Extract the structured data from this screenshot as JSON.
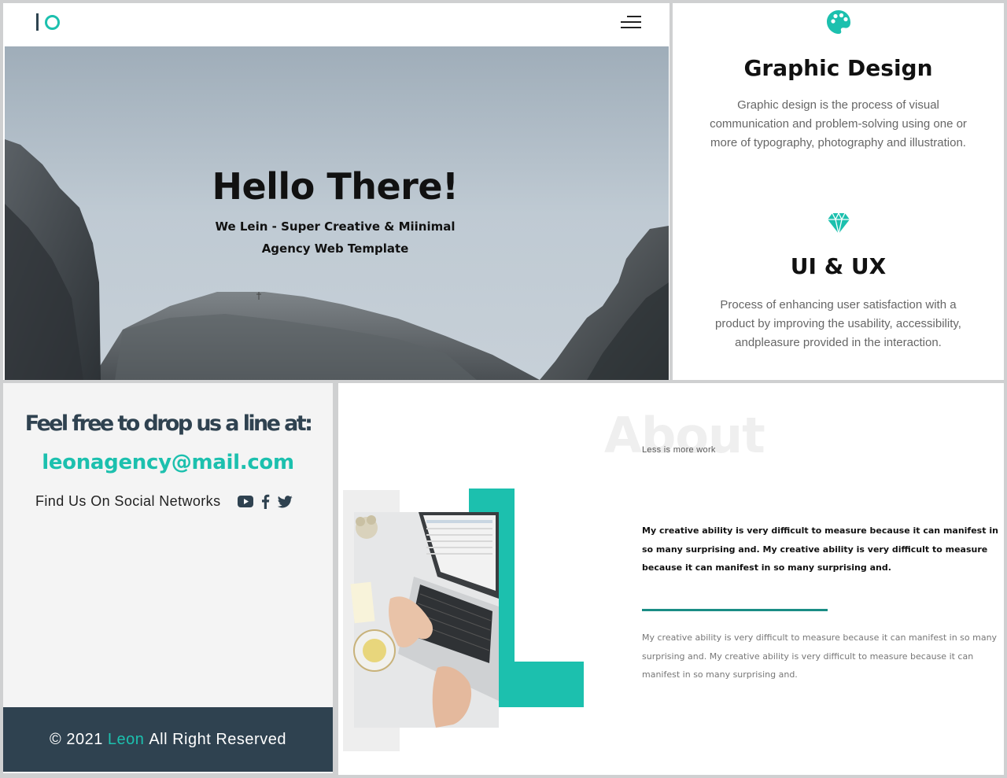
{
  "hero": {
    "title": "Hello There!",
    "subtitle_line1": "We Lein - Super Creative & Miinimal",
    "subtitle_line2": "Agency Web Template",
    "colors": {
      "accent": "#1cc0ae",
      "logo_dark": "#2e4450"
    },
    "icons": {
      "logo": "logo-io-mark",
      "menu": "hamburger-menu-icon"
    }
  },
  "services": [
    {
      "icon": "palette-icon",
      "title": "Graphic Design",
      "description": "Graphic design is the process of visual communication and problem-solving using one or more of typography, photography and illustration."
    },
    {
      "icon": "diamond-icon",
      "title": "UI & UX",
      "description": "Process of enhancing user satisfaction with a product by improving the usability, accessibility, andpleasure provided in the interaction."
    }
  ],
  "contact": {
    "heading": "Feel free to drop us a line at:",
    "email": "leonagency@mail.com",
    "social_label": "Find Us On Social Networks",
    "social_icons": [
      "youtube-icon",
      "facebook-icon",
      "twitter-icon"
    ]
  },
  "footer": {
    "copyright_prefix": "© 2021",
    "brand": "Leon",
    "suffix": "All Right Reserved",
    "colors": {
      "background": "#2f4250",
      "brand": "#1cc0ae"
    }
  },
  "about": {
    "bg_title": "About",
    "subtitle": "Less is more work",
    "paragraph_bold": "My creative ability is very difficult to measure because it can manifest in so many surprising and. My creative ability is very difficult to measure because it can manifest in so many surprising and.",
    "paragraph_light": "My creative ability is very difficult to measure because it can manifest in so many surprising and. My creative ability is very difficult to measure because it can manifest in so many surprising and."
  }
}
